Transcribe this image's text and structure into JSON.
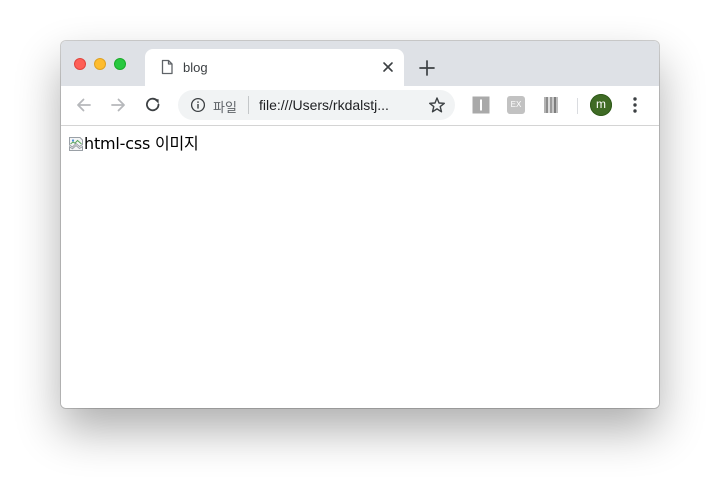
{
  "browser": {
    "tab": {
      "title": "blog",
      "icon": "document-icon"
    },
    "toolbar": {
      "back_icon": "arrow-back-icon",
      "forward_icon": "arrow-forward-icon",
      "reload_icon": "reload-icon",
      "omnibox": {
        "info_icon": "info-icon",
        "scheme_chip": "파일",
        "url": "file:///Users/rkdalstj..."
      },
      "bookmark_icon": "star-icon",
      "extensions": [
        "extension-icon",
        "ex-extension-icon",
        "extension-icon"
      ],
      "extension_ex_label": "EX",
      "profile_initial": "m",
      "menu_icon": "kebab-menu-icon"
    },
    "colors": {
      "tabstrip": "#dee1e6",
      "avatar": "#3f6b25"
    }
  },
  "page": {
    "image_alt": "html-css 이미지"
  }
}
